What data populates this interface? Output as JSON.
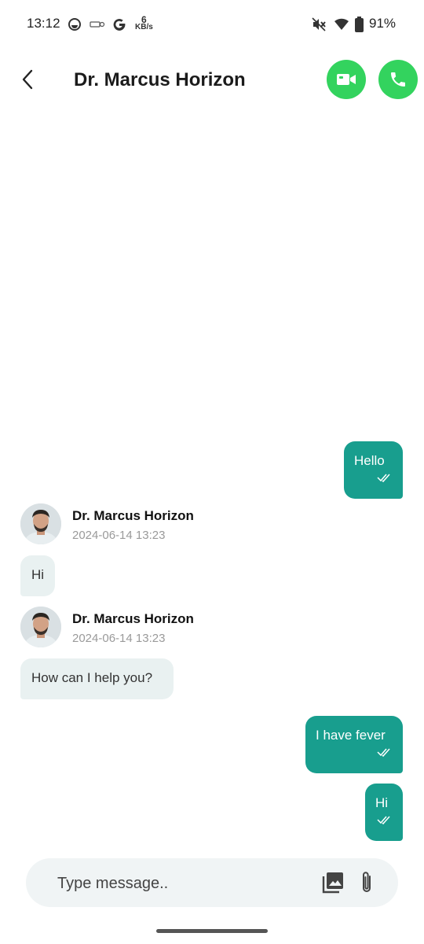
{
  "status_bar": {
    "time": "13:12",
    "network_speed_value": "6",
    "network_speed_unit": "KB/s",
    "battery_percent": "91%",
    "icons": [
      "data-saver-icon",
      "sim-icon",
      "google-icon",
      "mute-icon",
      "wifi-icon",
      "battery-icon"
    ]
  },
  "header": {
    "title": "Dr. Marcus Horizon",
    "back_icon": "chevron-left-icon",
    "video_icon": "video-camera-icon",
    "call_icon": "phone-icon"
  },
  "messages": [
    {
      "direction": "outgoing",
      "text": "Hello",
      "status": "read"
    },
    {
      "direction": "incoming",
      "sender": "Dr. Marcus Horizon",
      "timestamp": "2024-06-14 13:23",
      "text": "Hi"
    },
    {
      "direction": "incoming",
      "sender": "Dr. Marcus Horizon",
      "timestamp": "2024-06-14 13:23",
      "text": "How can I help you?"
    },
    {
      "direction": "outgoing",
      "text": "I have fever",
      "status": "read"
    },
    {
      "direction": "outgoing",
      "text": "Hi",
      "status": "read"
    }
  ],
  "composer": {
    "placeholder": "Type message..",
    "value": "",
    "gallery_icon": "image-gallery-icon",
    "attach_icon": "paperclip-icon"
  },
  "colors": {
    "outgoing_bubble": "#189e8e",
    "incoming_bubble": "#e9f1f1",
    "action_button": "#33d35e"
  }
}
